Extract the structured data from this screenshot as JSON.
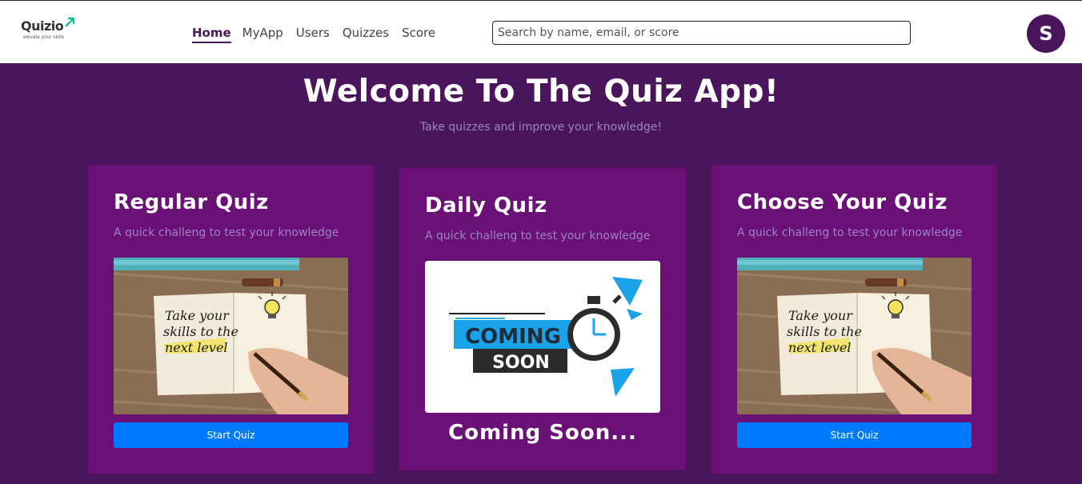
{
  "logo": {
    "name": "Quizio",
    "tagline": "elevate your skills"
  },
  "nav": {
    "items": [
      {
        "label": "Home",
        "active": true
      },
      {
        "label": "MyApp",
        "active": false
      },
      {
        "label": "Users",
        "active": false
      },
      {
        "label": "Quizzes",
        "active": false
      },
      {
        "label": "Score",
        "active": false
      }
    ]
  },
  "search": {
    "placeholder": "Search by name, email, or score",
    "value": ""
  },
  "user": {
    "initial": "S"
  },
  "hero": {
    "title": "Welcome To The Quiz App!",
    "subtitle": "Take quizzes and improve your knowledge!"
  },
  "cards": [
    {
      "title": "Regular Quiz",
      "description": "A quick challeng to test your knowledge",
      "image": {
        "icon": "notebook-illustration",
        "lines": [
          "Take your",
          "skills to the",
          "next level"
        ]
      },
      "button": "Start Quiz"
    },
    {
      "title": "Daily Quiz",
      "description": "A quick challeng to test your knowledge",
      "image": {
        "icon": "stopwatch-illustration",
        "lines": [
          "COMING",
          "SOON"
        ]
      },
      "status": "Coming Soon..."
    },
    {
      "title": "Choose Your Quiz",
      "description": "A quick challeng to test your knowledge",
      "image": {
        "icon": "notebook-illustration",
        "lines": [
          "Take your",
          "skills to the",
          "next level"
        ]
      },
      "button": "Start Quiz"
    }
  ],
  "colors": {
    "page_bg": "#4a155a",
    "card_bg": "#6b1077",
    "accent_button": "#007bff",
    "muted_text": "#9b86c0"
  }
}
